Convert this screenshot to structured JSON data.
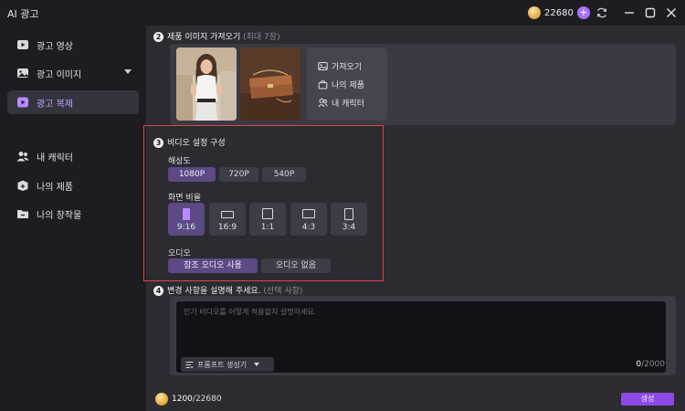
{
  "window": {
    "title": "AI 광고"
  },
  "header": {
    "credits": "22680",
    "plus": "+"
  },
  "sidebar": {
    "items": [
      {
        "label": "광고 영상",
        "icon": "video-icon"
      },
      {
        "label": "광고 이미지",
        "icon": "image-icon"
      },
      {
        "label": "광고 복제",
        "icon": "duplicate-icon",
        "active": true
      },
      {
        "label": "내 캐릭터",
        "icon": "users-icon"
      },
      {
        "label": "나의 제품",
        "icon": "product-box-icon"
      },
      {
        "label": "나의 창작물",
        "icon": "folder-icon"
      }
    ]
  },
  "product_images": {
    "step": "2",
    "title": "제품 이미지 가져오기",
    "hint": "(최대 7장)",
    "import_options": [
      {
        "label": "가져오기",
        "icon": "image-upload-icon"
      },
      {
        "label": "나의 제품",
        "icon": "bag-icon"
      },
      {
        "label": "내 캐릭터",
        "icon": "people-icon"
      }
    ]
  },
  "video_settings": {
    "step": "3",
    "title": "비디오 설정 구성",
    "resolution_label": "해상도",
    "resolutions": [
      "1080P",
      "720P",
      "540P"
    ],
    "resolution_selected": "1080P",
    "ratio_label": "화면 비율",
    "ratios": [
      "9:16",
      "16:9",
      "1:1",
      "4:3",
      "3:4"
    ],
    "ratio_selected": "9:16",
    "audio_label": "오디오",
    "audio_options": [
      "참조 오디오 사용",
      "오디오 없음"
    ],
    "audio_selected": "참조 오디오 사용"
  },
  "describe": {
    "step": "4",
    "title": "변경 사항을 설명해 주세요.",
    "hint": "(선택 사항)",
    "placeholder": "인기 비디오를 어떻게 적용할지 설명하세요.",
    "prompt_generator": "프롬프트 생성기",
    "count": "0",
    "max": "/2000"
  },
  "footer": {
    "used": "1200",
    "total": "/22680",
    "generate": "생성"
  },
  "colors": {
    "accent": "#8d49e8",
    "selected": "#5b4a84",
    "highlight": "#e0453f"
  }
}
